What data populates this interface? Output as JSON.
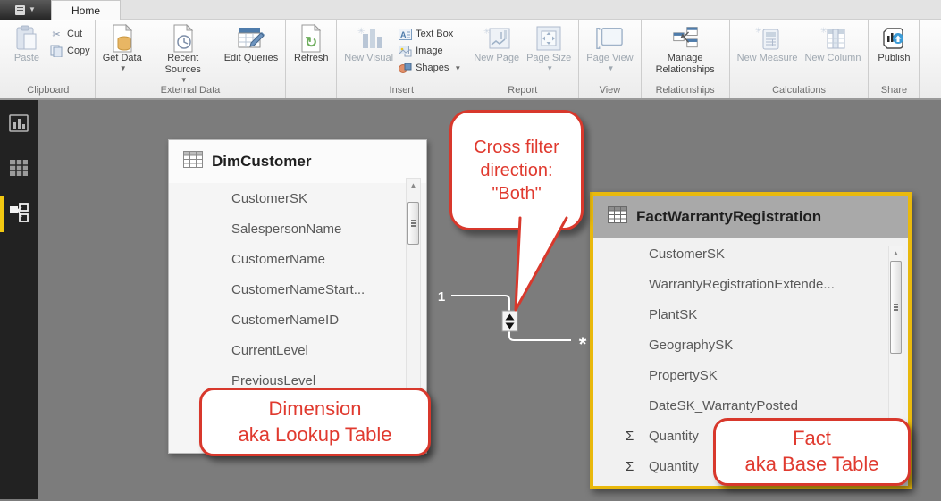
{
  "titlebar": {
    "home_tab": "Home"
  },
  "ribbon": {
    "clipboard": {
      "label": "Clipboard",
      "paste": "Paste",
      "cut": "Cut",
      "copy": "Copy"
    },
    "external_data": {
      "label": "External Data",
      "get_data": "Get Data",
      "recent_sources": "Recent Sources",
      "edit_queries": "Edit Queries",
      "refresh": "Refresh"
    },
    "insert": {
      "label": "Insert",
      "new_visual": "New Visual",
      "text_box": "Text Box",
      "image": "Image",
      "shapes": "Shapes"
    },
    "report": {
      "label": "Report",
      "new_page": "New Page",
      "page_size": "Page Size"
    },
    "view": {
      "label": "View",
      "page_view": "Page View"
    },
    "relationships": {
      "label": "Relationships",
      "manage_relationships": "Manage Relationships"
    },
    "calculations": {
      "label": "Calculations",
      "new_measure": "New Measure",
      "new_column": "New Column"
    },
    "share": {
      "label": "Share",
      "publish": "Publish"
    }
  },
  "sidebar": {
    "items": [
      {
        "name": "report-view",
        "icon": "bar-chart-icon",
        "active": false
      },
      {
        "name": "data-view",
        "icon": "data-grid-icon",
        "active": false
      },
      {
        "name": "relationships-view",
        "icon": "model-diagram-icon",
        "active": true
      }
    ]
  },
  "canvas": {
    "dim_table": {
      "title": "DimCustomer",
      "fields": [
        "CustomerSK",
        "SalespersonName",
        "CustomerName",
        "CustomerNameStart...",
        "CustomerNameID",
        "CurrentLevel",
        "PreviousLevel"
      ]
    },
    "fact_table": {
      "title": "FactWarrantyRegistration",
      "fields": [
        {
          "name": "CustomerSK",
          "agg": false
        },
        {
          "name": "WarrantyRegistrationExtende...",
          "agg": false
        },
        {
          "name": "PlantSK",
          "agg": false
        },
        {
          "name": "GeographySK",
          "agg": false
        },
        {
          "name": "PropertySK",
          "agg": false
        },
        {
          "name": "DateSK_WarrantyPosted",
          "agg": false
        },
        {
          "name": "Quantity",
          "agg": true
        },
        {
          "name": "Quantity",
          "agg": true
        }
      ],
      "sigma_glyph": "Σ"
    },
    "relationship": {
      "one_label": "1",
      "many_label": "*",
      "direction": "both"
    },
    "callouts": {
      "cross_filter": {
        "line1": "Cross filter",
        "line2": "direction:",
        "line3": "\"Both\""
      },
      "dimension": {
        "line1": "Dimension",
        "line2": "aka Lookup Table"
      },
      "fact": {
        "line1": "Fact",
        "line2": "aka Base Table"
      }
    }
  },
  "colors": {
    "accent_yellow": "#F2C811",
    "selected_table_border": "#E9B90D",
    "callout_red": "#D8382C",
    "canvas_gray": "#7c7c7c",
    "sidebar_dark": "#222222"
  }
}
